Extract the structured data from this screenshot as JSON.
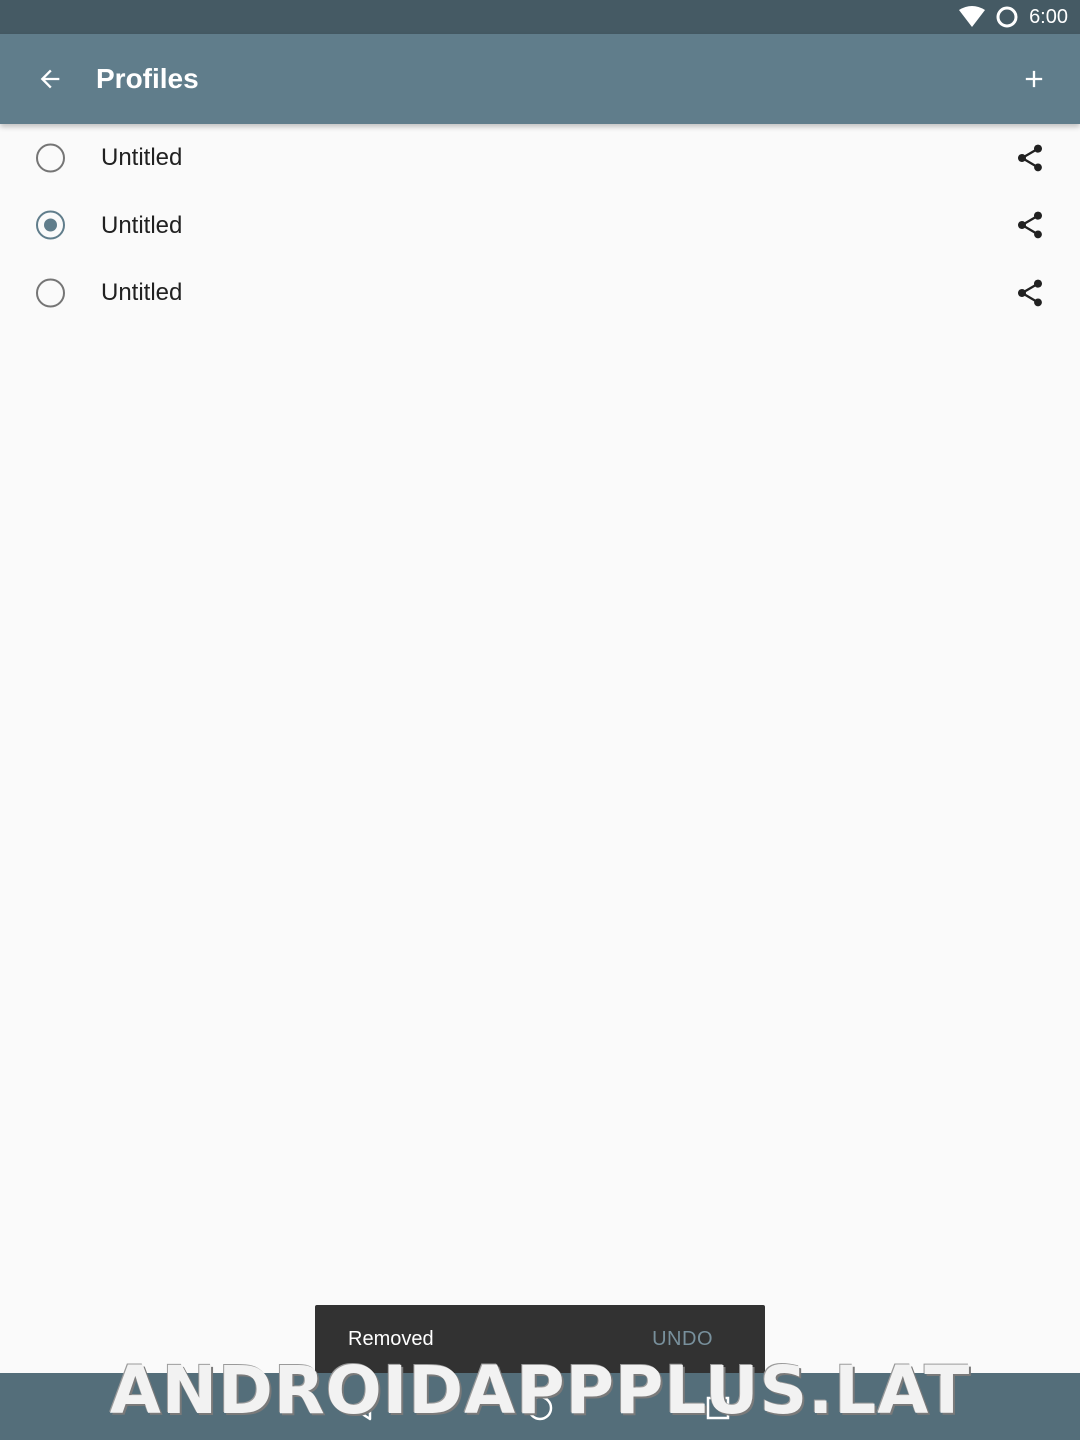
{
  "status_bar": {
    "time": "6:00"
  },
  "app_bar": {
    "title": "Profiles"
  },
  "profiles": [
    {
      "name": "Untitled",
      "selected": false
    },
    {
      "name": "Untitled",
      "selected": true
    },
    {
      "name": "Untitled",
      "selected": false
    }
  ],
  "snackbar": {
    "message": "Removed",
    "action": "UNDO"
  },
  "watermark": "ANDROIDAPPPLUS.LAT",
  "colors": {
    "primary": "#607d8b",
    "primary_dark": "#455a64",
    "snackbar_action": "#78909c"
  }
}
